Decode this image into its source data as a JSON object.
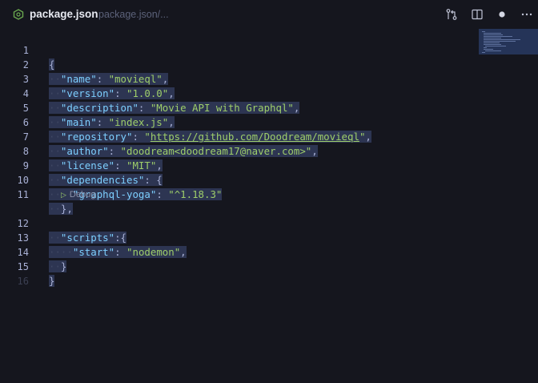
{
  "tab": {
    "title": "package.json",
    "breadcrumb": "package.json/...",
    "icon": "nodejs-icon"
  },
  "toolbar": {
    "actions": [
      "compare-changes-icon",
      "split-editor-icon",
      "unsaved-dot-icon",
      "more-actions-icon"
    ]
  },
  "editor": {
    "line_numbers": [
      "1",
      "2",
      "3",
      "4",
      "5",
      "6",
      "7",
      "8",
      "9",
      "10",
      "11",
      "12",
      "13",
      "14",
      "15",
      "16"
    ],
    "codelens": "Debug",
    "json": {
      "name": "movieql",
      "version": "1.0.0",
      "description": "Movie API with Graphql",
      "main": "index.js",
      "repository": "https://github.com/Doodream/movieql",
      "author": "doodream<doodream17@naver.com>",
      "license": "MIT",
      "dependencies_key": "dependencies",
      "graphql_yoga_key": "graphql-yoga",
      "graphql_yoga": "^1.18.3",
      "scripts_key": "scripts",
      "start_key": "start",
      "start": "nodemon"
    }
  },
  "colors": {
    "background": "#15161e",
    "selection": "#2d3552",
    "key": "#7dcfff",
    "string": "#9ece6a",
    "punctuation": "#a9b1d6"
  }
}
